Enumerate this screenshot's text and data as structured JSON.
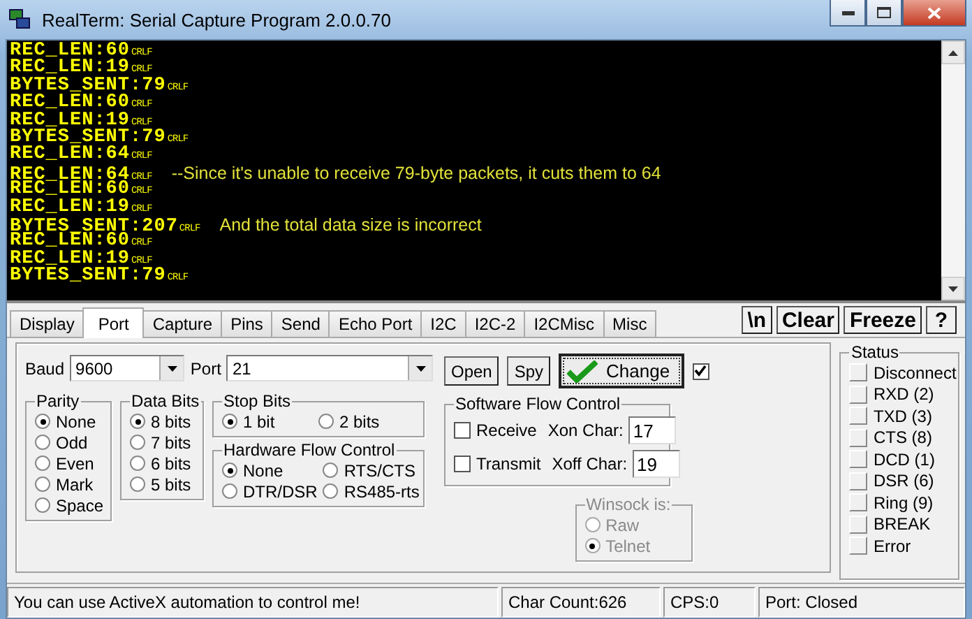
{
  "window": {
    "title": "RealTerm: Serial Capture Program 2.0.0.70"
  },
  "terminal": {
    "lines": [
      {
        "text": "REC_LEN:60",
        "eol": "CRLF"
      },
      {
        "text": "REC_LEN:19",
        "eol": "CRLF"
      },
      {
        "text": "BYTES_SENT:79",
        "eol": "CRLF"
      },
      {
        "text": "REC_LEN:60",
        "eol": "CRLF"
      },
      {
        "text": "REC_LEN:19",
        "eol": "CRLF"
      },
      {
        "text": "BYTES_SENT:79",
        "eol": "CRLF"
      },
      {
        "text": "REC_LEN:64",
        "eol": "CRLF"
      },
      {
        "text": "REC_LEN:64",
        "eol": "CRLF",
        "note": "--Since it's unable to receive 79-byte packets, it cuts them to 64"
      },
      {
        "text": "REC_LEN:60",
        "eol": "CRLF"
      },
      {
        "text": "REC_LEN:19",
        "eol": "CRLF"
      },
      {
        "text": "BYTES_SENT:207",
        "eol": "CRLF",
        "note": "And the total data size is incorrect"
      },
      {
        "text": "REC_LEN:60",
        "eol": "CRLF"
      },
      {
        "text": "REC_LEN:19",
        "eol": "CRLF"
      },
      {
        "text": "BYTES_SENT:79",
        "eol": "CRLF"
      }
    ]
  },
  "tabs": [
    {
      "label": "Display",
      "selected": false
    },
    {
      "label": "Port",
      "selected": true
    },
    {
      "label": "Capture",
      "selected": false
    },
    {
      "label": "Pins",
      "selected": false
    },
    {
      "label": "Send",
      "selected": false
    },
    {
      "label": "Echo Port",
      "selected": false
    },
    {
      "label": "I2C",
      "selected": false
    },
    {
      "label": "I2C-2",
      "selected": false
    },
    {
      "label": "I2CMisc",
      "selected": false
    },
    {
      "label": "Misc",
      "selected": false
    }
  ],
  "toolbar_buttons": [
    "\\n",
    "Clear",
    "Freeze",
    "?"
  ],
  "port": {
    "baud": {
      "label": "Baud",
      "value": "9600"
    },
    "port": {
      "label": "Port",
      "value": "21"
    },
    "buttons": [
      {
        "label": "Open",
        "kind": "plain"
      },
      {
        "label": "Spy",
        "kind": "plain"
      },
      {
        "label": "Change",
        "kind": "check"
      }
    ],
    "change_checkbox": {
      "checked": true
    },
    "parity": {
      "title": "Parity",
      "options": [
        {
          "label": "None",
          "selected": true
        },
        {
          "label": "Odd",
          "selected": false
        },
        {
          "label": "Even",
          "selected": false
        },
        {
          "label": "Mark",
          "selected": false
        },
        {
          "label": "Space",
          "selected": false
        }
      ]
    },
    "data_bits": {
      "title": "Data Bits",
      "options": [
        {
          "label": "8 bits",
          "selected": true
        },
        {
          "label": "7 bits",
          "selected": false
        },
        {
          "label": "6 bits",
          "selected": false
        },
        {
          "label": "5 bits",
          "selected": false
        }
      ]
    },
    "stop_bits": {
      "title": "Stop Bits",
      "options": [
        {
          "label": "1 bit",
          "selected": true
        },
        {
          "label": "2 bits",
          "selected": false
        }
      ]
    },
    "hardware_flow": {
      "title": "Hardware Flow Control",
      "options": [
        {
          "label": "None",
          "selected": true
        },
        {
          "label": "RTS/CTS",
          "selected": false
        },
        {
          "label": "DTR/DSR",
          "selected": false
        },
        {
          "label": "RS485-rts",
          "selected": false
        }
      ]
    },
    "software_flow": {
      "title": "Software Flow Control",
      "rows": [
        {
          "label": "Receive",
          "checked": false,
          "char_label": "Xon Char:",
          "char_value": "17"
        },
        {
          "label": "Transmit",
          "checked": false,
          "char_label": "Xoff Char:",
          "char_value": "19"
        }
      ]
    },
    "winsock": {
      "title": "Winsock is:",
      "disabled": true,
      "options": [
        {
          "label": "Raw",
          "selected": false
        },
        {
          "label": "Telnet",
          "selected": true
        }
      ]
    }
  },
  "status": {
    "title": "Status",
    "items": [
      {
        "label": "Disconnect",
        "on": false
      },
      {
        "label": "RXD (2)",
        "on": false
      },
      {
        "label": "TXD (3)",
        "on": false
      },
      {
        "label": "CTS (8)",
        "on": false
      },
      {
        "label": "DCD (1)",
        "on": false
      },
      {
        "label": "DSR (6)",
        "on": false
      },
      {
        "label": "Ring (9)",
        "on": false
      },
      {
        "label": "BREAK",
        "on": false
      },
      {
        "label": "Error",
        "on": false
      }
    ]
  },
  "status_bar": {
    "message": "You can use ActiveX automation to control me!",
    "char_count": "Char Count:626",
    "cps": "CPS:0",
    "port_state": "Port: Closed"
  }
}
